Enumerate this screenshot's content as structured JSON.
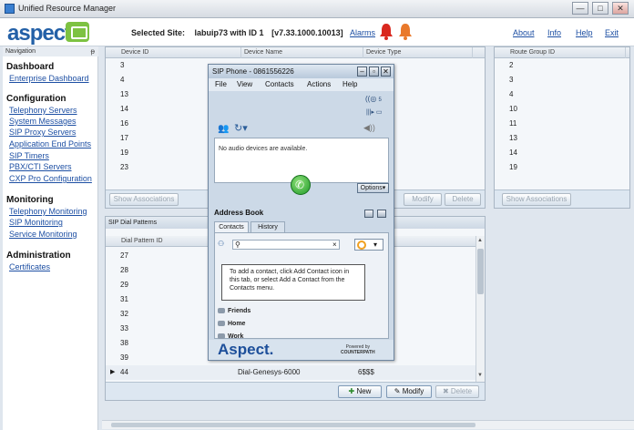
{
  "window": {
    "title": "Unified Resource Manager",
    "minimize": "—",
    "maximize": "□",
    "close": "✕"
  },
  "header": {
    "logo": "aspect",
    "site_label": "Selected Site:",
    "site_value": "labuip73 with ID 1",
    "version": "[v7.33.1000.10013]",
    "alarms": "Alarms",
    "links": [
      "About",
      "Info",
      "Help",
      "Exit"
    ]
  },
  "nav": {
    "title": "Navigation",
    "pin": "ᵽ",
    "sections": [
      {
        "heading": "Dashboard",
        "items": [
          "Enterprise Dashboard"
        ]
      },
      {
        "heading": "Configuration",
        "items": [
          "Telephony Servers",
          "System Messages",
          "SIP Proxy Servers",
          "Application End Points",
          "SIP Timers",
          "PBX/CTI Servers",
          "CXP Pro Configuration"
        ]
      },
      {
        "heading": "Monitoring",
        "items": [
          "Telephony Monitoring",
          "SIP Monitoring",
          "Service Monitoring"
        ]
      },
      {
        "heading": "Administration",
        "items": [
          "Certificates"
        ]
      }
    ]
  },
  "devices_panel": {
    "columns": [
      "Device ID",
      "Device Name",
      "Device Type"
    ],
    "rows": [
      "3",
      "4",
      "13",
      "14",
      "16",
      "17",
      "19",
      "23"
    ],
    "buttons": {
      "show_associations": "Show Associations",
      "modify": "Modify",
      "delete": "Delete"
    }
  },
  "route_panel": {
    "columns": [
      "Route Group ID"
    ],
    "rows": [
      "2",
      "3",
      "4",
      "10",
      "11",
      "13",
      "14",
      "19"
    ],
    "buttons": {
      "show_associations": "Show Associations"
    }
  },
  "dial_panel": {
    "title": "SIP Dial Patterns",
    "columns": [
      "Dial Pattern ID"
    ],
    "rows": [
      "27",
      "28",
      "29",
      "31",
      "32",
      "33",
      "38",
      "39",
      "44"
    ],
    "selected_row": {
      "name": "Dial-Genesys-6000",
      "value": "6$$$"
    },
    "buttons": {
      "new": "New",
      "modify": "Modify",
      "delete": "Delete"
    }
  },
  "sip_phone": {
    "title": "SIP Phone - 0861556226",
    "menu": [
      "File",
      "View",
      "Contacts",
      "Actions",
      "Help"
    ],
    "status_count": "5",
    "no_audio": "No audio devices are available.",
    "options": "Options",
    "address_book": {
      "title": "Address Book",
      "tabs": [
        "Contacts",
        "History"
      ],
      "message": "To add a contact, click Add Contact icon in this tab, or select Add a Contact from the Contacts menu.",
      "groups": [
        "Friends",
        "Home",
        "Work"
      ]
    },
    "brand": "Aspect.",
    "powered_by": "Powered by",
    "counterpath": "COUNTERPATH"
  },
  "colors": {
    "link": "#1d4fa3",
    "brand_blue": "#2360a7",
    "brand_green": "#7dc242",
    "alarm_red": "#d9281f",
    "alarm_orange": "#e9792b"
  }
}
